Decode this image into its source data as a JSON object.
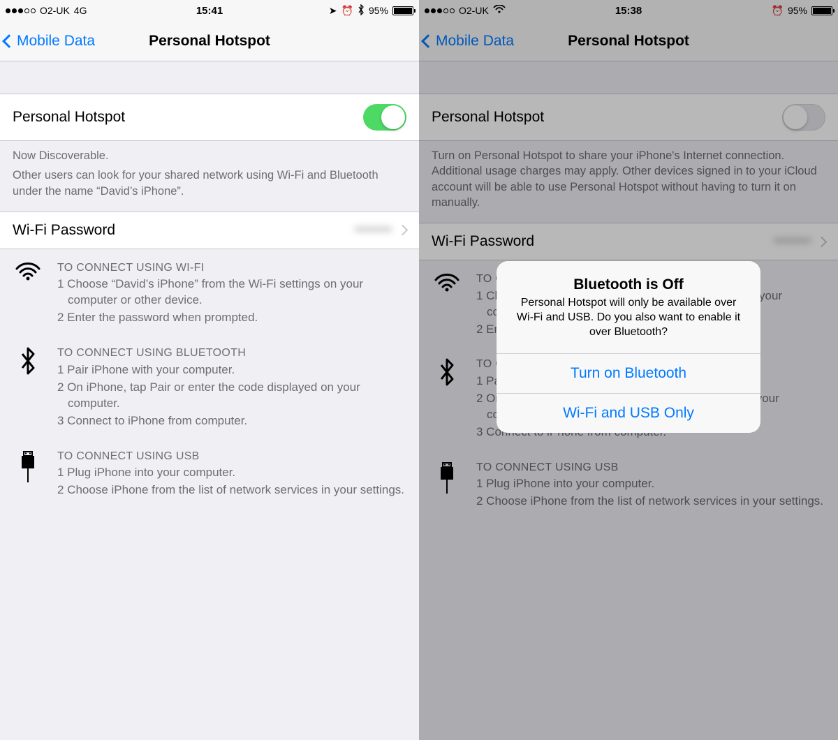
{
  "left": {
    "statusbar": {
      "carrier": "O2-UK",
      "network": "4G",
      "time": "15:41",
      "battery_pct": "95%"
    },
    "nav": {
      "back": "Mobile Data",
      "title": "Personal Hotspot"
    },
    "hotspot_row": {
      "label": "Personal Hotspot"
    },
    "discoverable": {
      "line1": "Now Discoverable.",
      "line2": "Other users can look for your shared network using Wi-Fi and Bluetooth under the name “David’s iPhone”."
    },
    "password_row": {
      "label": "Wi-Fi Password",
      "value": "••••••••"
    },
    "wifi": {
      "title": "TO CONNECT USING WI-FI",
      "s1": "1 Choose “David’s iPhone” from the Wi-Fi settings on your computer or other device.",
      "s2": "2 Enter the password when prompted."
    },
    "bt": {
      "title": "TO CONNECT USING BLUETOOTH",
      "s1": "1 Pair iPhone with your computer.",
      "s2": "2 On iPhone, tap Pair or enter the code displayed on your computer.",
      "s3": "3 Connect to iPhone from computer."
    },
    "usb": {
      "title": "TO CONNECT USING USB",
      "s1": "1 Plug iPhone into your computer.",
      "s2": "2 Choose iPhone from the list of network services in your settings."
    }
  },
  "right": {
    "statusbar": {
      "carrier": "O2-UK",
      "time": "15:38",
      "battery_pct": "95%"
    },
    "nav": {
      "back": "Mobile Data",
      "title": "Personal Hotspot"
    },
    "hotspot_row": {
      "label": "Personal Hotspot"
    },
    "discoverable": {
      "text": "Turn on Personal Hotspot to share your iPhone's Internet connection. Additional usage charges may apply. Other devices signed in to your iCloud account will be able to use Personal Hotspot without having to turn it on manually."
    },
    "password_row": {
      "label": "Wi-Fi Password",
      "value": "••••••••"
    },
    "wifi": {
      "title": "TO CONNECT USING WI-FI",
      "s1": "1 Choose “David’s iPhone” from the Wi-Fi settings on your computer or other device.",
      "s2": "2 Enter the password when prompted."
    },
    "bt": {
      "title": "TO CONNECT USING BLUETOOTH",
      "s1": "1 Pair iPhone with your computer.",
      "s2": "2 On iPhone, tap Pair or enter the code displayed on your computer.",
      "s3": "3 Connect to iPhone from computer."
    },
    "usb": {
      "title": "TO CONNECT USING USB",
      "s1": "1 Plug iPhone into your computer.",
      "s2": "2 Choose iPhone from the list of network services in your settings."
    },
    "alert": {
      "title": "Bluetooth is Off",
      "message": "Personal Hotspot will only be available over Wi-Fi and USB. Do you also want to enable it over Bluetooth?",
      "btn1": "Turn on Bluetooth",
      "btn2": "Wi-Fi and USB Only"
    }
  }
}
